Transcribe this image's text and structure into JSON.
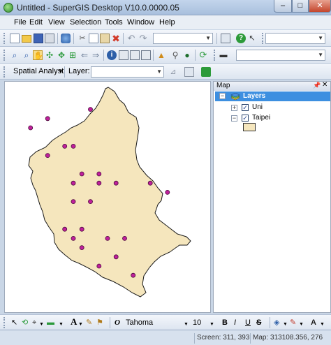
{
  "window": {
    "title": "Untitled - SuperGIS Desktop V10.0.0000.05",
    "minimize_glyph": "–",
    "maximize_glyph": "□",
    "close_glyph": "✕"
  },
  "menu": {
    "items": [
      "File",
      "Edit",
      "View",
      "Selection",
      "Tools",
      "Window",
      "Help"
    ]
  },
  "toolbar3": {
    "spatial_analyst_label": "Spatial Analyst",
    "layer_label": "Layer:",
    "layer_value": ""
  },
  "map_panel": {
    "title": "Map",
    "pin_glyph": "📌",
    "close_glyph": "✕",
    "root_label": "Layers",
    "layers": [
      {
        "name": "Uni",
        "checked": true,
        "expanded": false
      },
      {
        "name": "Taipei",
        "checked": true,
        "expanded": true
      }
    ],
    "check_glyph": "✓",
    "collapse_glyph": "−",
    "expand_glyph": "+"
  },
  "map": {
    "polygon_fill": "#f5e6bd",
    "polygon_stroke": "#1a1a1a",
    "point_color": "#c0209c",
    "points": [
      {
        "lon": 121.48,
        "lat": 25.17
      },
      {
        "lon": 121.46,
        "lat": 25.16
      },
      {
        "lon": 121.53,
        "lat": 25.18
      },
      {
        "lon": 121.5,
        "lat": 25.14
      },
      {
        "lon": 121.51,
        "lat": 25.14
      },
      {
        "lon": 121.48,
        "lat": 25.13
      },
      {
        "lon": 121.52,
        "lat": 25.11
      },
      {
        "lon": 121.54,
        "lat": 25.11
      },
      {
        "lon": 121.51,
        "lat": 25.1
      },
      {
        "lon": 121.54,
        "lat": 25.1
      },
      {
        "lon": 121.56,
        "lat": 25.1
      },
      {
        "lon": 121.6,
        "lat": 25.1
      },
      {
        "lon": 121.62,
        "lat": 25.09
      },
      {
        "lon": 121.51,
        "lat": 25.08
      },
      {
        "lon": 121.53,
        "lat": 25.08
      },
      {
        "lon": 121.5,
        "lat": 25.05
      },
      {
        "lon": 121.51,
        "lat": 25.04
      },
      {
        "lon": 121.52,
        "lat": 25.05
      },
      {
        "lon": 121.55,
        "lat": 25.04
      },
      {
        "lon": 121.57,
        "lat": 25.04
      },
      {
        "lon": 121.52,
        "lat": 25.03
      },
      {
        "lon": 121.56,
        "lat": 25.02
      },
      {
        "lon": 121.54,
        "lat": 25.01
      },
      {
        "lon": 121.58,
        "lat": 25.0
      }
    ]
  },
  "bottom_toolbar": {
    "font_name": "Tahoma",
    "font_size": "10",
    "bold": "B",
    "italic": "I",
    "underline": "U",
    "strike": "S",
    "text_tool": "A",
    "italic_o": "O"
  },
  "status": {
    "screen": "Screen: 311, 393",
    "map": "Map: 313108.356, 276"
  }
}
